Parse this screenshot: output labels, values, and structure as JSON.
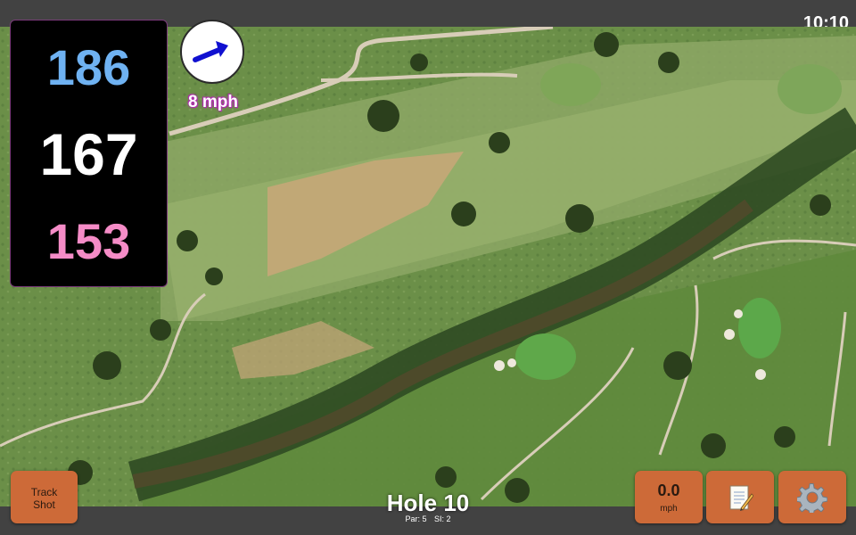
{
  "status": {
    "clock": "10:10"
  },
  "distances": {
    "back": "186",
    "middle": "167",
    "front": "153"
  },
  "wind": {
    "speed_text": "8 mph",
    "icon": "arrow-right-up-icon"
  },
  "hole": {
    "title": "Hole 10",
    "par_label": "Par: 5",
    "si_label": "SI: 2"
  },
  "buttons": {
    "track_shot_line1": "Track",
    "track_shot_line2": "Shot",
    "speed_value": "0.0",
    "speed_unit": "mph",
    "notes_icon": "notepad-icon",
    "settings_icon": "gear-icon"
  },
  "colors": {
    "back_distance": "#6fb2f2",
    "middle_distance": "#ffffff",
    "front_distance": "#f58cc7",
    "button": "#cd6a38",
    "wind_arrow": "#1010d0"
  }
}
